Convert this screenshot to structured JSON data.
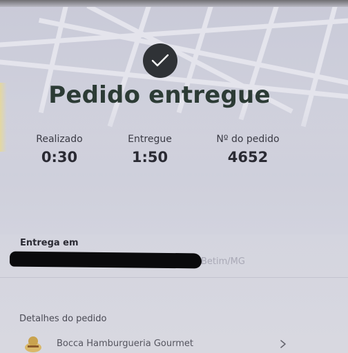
{
  "order_status": {
    "title": "Pedido entregue",
    "check_icon": "checkmark-icon"
  },
  "stats": [
    {
      "label": "Realizado",
      "value": "0:30"
    },
    {
      "label": "Entregue",
      "value": "1:50"
    },
    {
      "label": "Nº do pedido",
      "value": "4652"
    }
  ],
  "delivery": {
    "heading": "Entrega em",
    "city": "Betim/MG"
  },
  "details": {
    "heading": "Detalhes do pedido",
    "restaurant_name": "Bocca Hamburgueria Gourmet",
    "restaurant_icon": "restaurant-logo-icon",
    "chevron_icon": "chevron-right-icon"
  },
  "colors": {
    "title": "#2c3b35",
    "badge": "#2f3236",
    "background": "#d2d3de"
  }
}
